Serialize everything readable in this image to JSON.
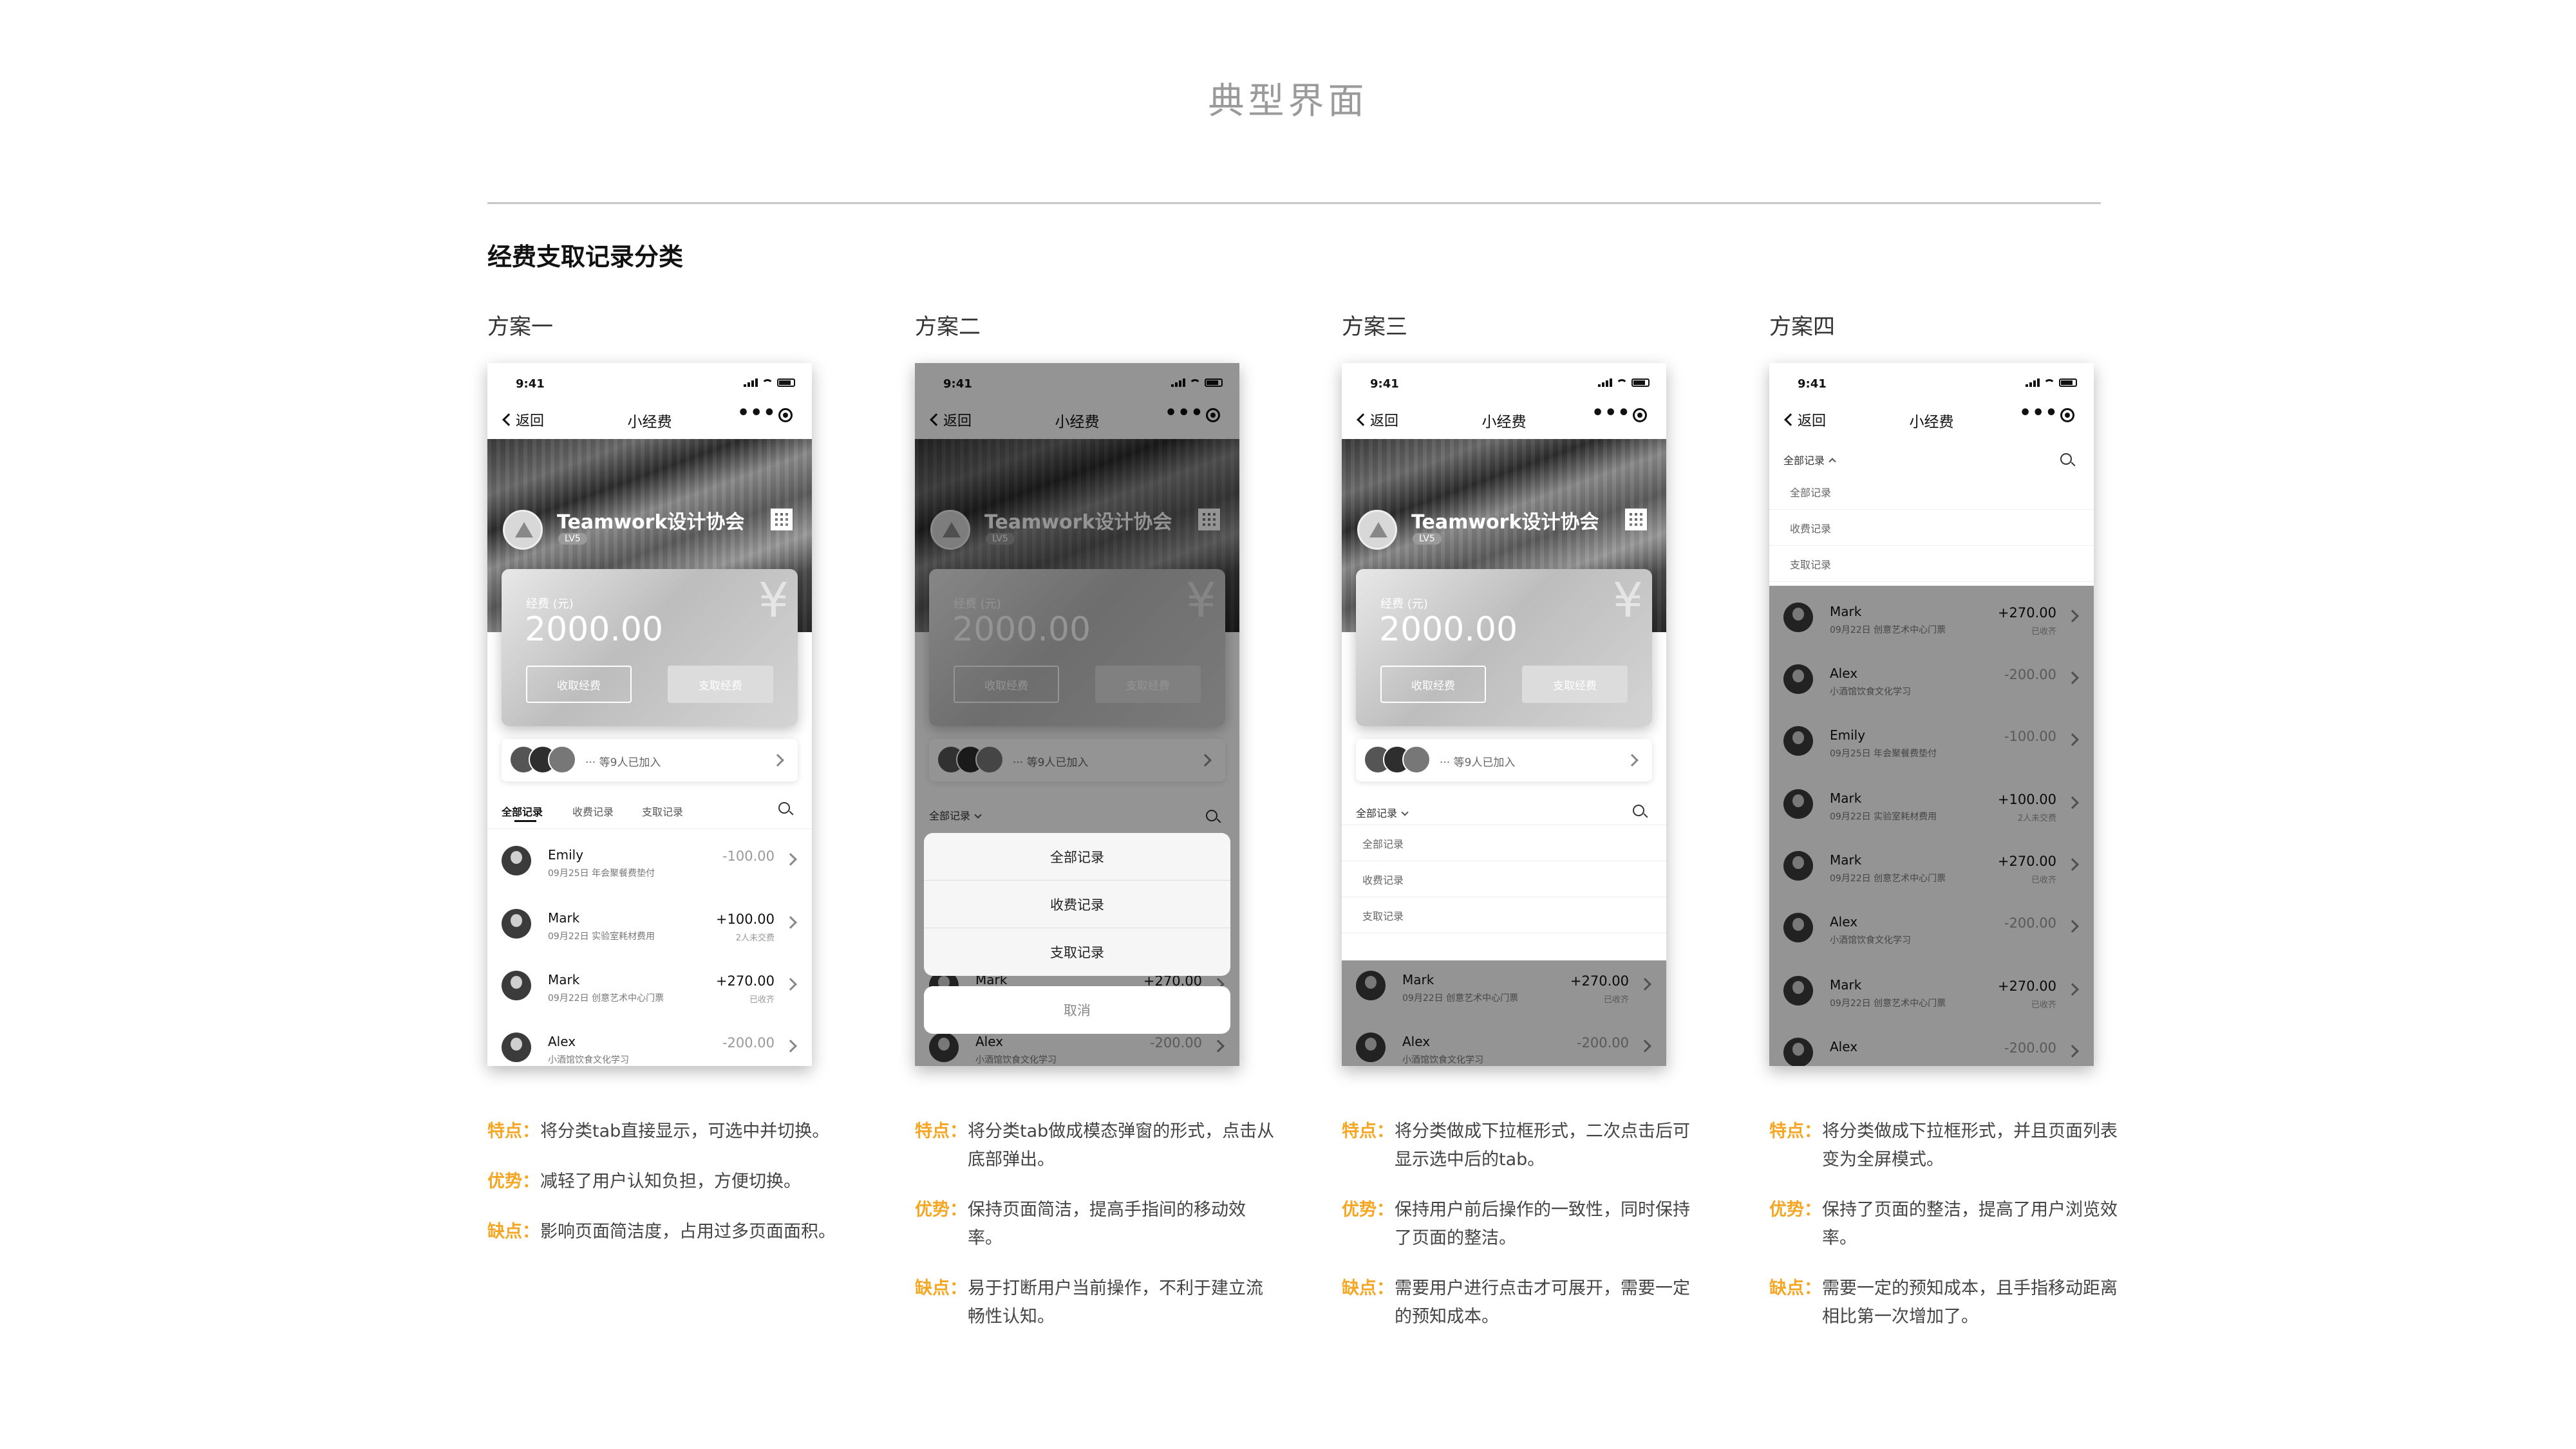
{
  "page": {
    "title": "典型界面",
    "section_title": "经费支取记录分类"
  },
  "phone_common": {
    "time": "9:41",
    "back": "返回",
    "title": "小经费",
    "more": "•••",
    "club_name": "Teamwork设计协会",
    "level": "LV5",
    "fund_label": "经费 (元)",
    "fund_amount": "2000.00",
    "yen": "¥",
    "btn_collect": "收取经费",
    "btn_withdraw": "支取经费",
    "members_text": "··· 等9人已加入",
    "tabs": [
      "全部记录",
      "收费记录",
      "支取记录"
    ],
    "dropdown_head": "全部记录",
    "cancel": "取消"
  },
  "records": [
    {
      "name": "Emily",
      "desc": "09月25日  年会聚餐费垫付",
      "amount": "-100.00",
      "sub": ""
    },
    {
      "name": "Mark",
      "desc": "09月22日  实验室耗材费用",
      "amount": "+100.00",
      "sub": "2人未交费"
    },
    {
      "name": "Mark",
      "desc": "09月22日  创意艺术中心门票",
      "amount": "+270.00",
      "sub": "已收齐"
    },
    {
      "name": "Alex",
      "desc": "小酒馆饮食文化学习",
      "amount": "-200.00",
      "sub": ""
    }
  ],
  "records_full": [
    {
      "name": "Mark",
      "desc": "09月22日  创意艺术中心门票",
      "amount": "+270.00",
      "sub": "已收齐"
    },
    {
      "name": "Alex",
      "desc": "小酒馆饮食文化学习",
      "amount": "-200.00",
      "sub": ""
    },
    {
      "name": "Emily",
      "desc": "09月25日  年会聚餐费垫付",
      "amount": "-100.00",
      "sub": ""
    },
    {
      "name": "Mark",
      "desc": "09月22日  实验室耗材费用",
      "amount": "+100.00",
      "sub": "2人未交费"
    },
    {
      "name": "Mark",
      "desc": "09月22日  创意艺术中心门票",
      "amount": "+270.00",
      "sub": "已收齐"
    },
    {
      "name": "Alex",
      "desc": "小酒馆饮食文化学习",
      "amount": "-200.00",
      "sub": ""
    },
    {
      "name": "Mark",
      "desc": "09月22日  创意艺术中心门票",
      "amount": "+270.00",
      "sub": "已收齐"
    },
    {
      "name": "Alex",
      "desc": "",
      "amount": "-200.00",
      "sub": ""
    }
  ],
  "schemes": [
    {
      "title": "方案一",
      "notes": [
        {
          "label": "特点：",
          "text": "将分类tab直接显示，可选中并切换。"
        },
        {
          "label": "优势：",
          "text": "减轻了用户认知负担，方便切换。"
        },
        {
          "label": "缺点：",
          "text": "影响页面简洁度，占用过多页面面积。"
        }
      ]
    },
    {
      "title": "方案二",
      "notes": [
        {
          "label": "特点：",
          "text": "将分类tab做成模态弹窗的形式，点击从底部弹出。"
        },
        {
          "label": "优势：",
          "text": "保持页面简洁，提高手指间的移动效率。"
        },
        {
          "label": "缺点：",
          "text": "易于打断用户当前操作，不利于建立流畅性认知。"
        }
      ]
    },
    {
      "title": "方案三",
      "notes": [
        {
          "label": "特点：",
          "text": "将分类做成下拉框形式，二次点击后可显示选中后的tab。"
        },
        {
          "label": "优势：",
          "text": "保持用户前后操作的一致性，同时保持了页面的整洁。"
        },
        {
          "label": "缺点：",
          "text": "需要用户进行点击才可展开，需要一定的预知成本。"
        }
      ]
    },
    {
      "title": "方案四",
      "notes": [
        {
          "label": "特点：",
          "text": "将分类做成下拉框形式，并且页面列表变为全屏模式。"
        },
        {
          "label": "优势：",
          "text": "保持了页面的整洁，提高了用户浏览效率。"
        },
        {
          "label": "缺点：",
          "text": "需要一定的预知成本，且手指移动距离相比第一次增加了。"
        }
      ]
    }
  ],
  "colors": {
    "accent": "#f5a623",
    "dim_overlay": "rgba(0,0,0,0.42)"
  }
}
